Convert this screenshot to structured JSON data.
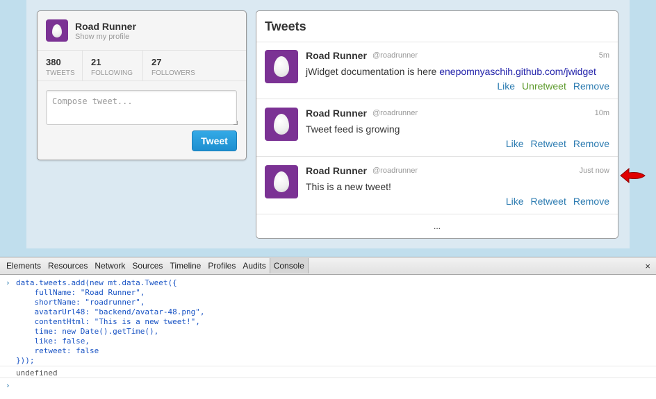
{
  "profile": {
    "name": "Road Runner",
    "link": "Show my profile",
    "stats": [
      {
        "num": "380",
        "label": "TWEETS"
      },
      {
        "num": "21",
        "label": "FOLLOWING"
      },
      {
        "num": "27",
        "label": "FOLLOWERS"
      }
    ],
    "compose_placeholder": "Compose tweet...",
    "tweet_button": "Tweet"
  },
  "tweets": {
    "title": "Tweets",
    "items": [
      {
        "name": "Road Runner",
        "handle": "@roadrunner",
        "time": "5m",
        "text": "jWidget documentation is here ",
        "link": "enepomnyaschih.github.com/jwidget",
        "like": "Like",
        "retweet": "Unretweet",
        "remove": "Remove"
      },
      {
        "name": "Road Runner",
        "handle": "@roadrunner",
        "time": "10m",
        "text": "Tweet feed is growing",
        "like": "Like",
        "retweet": "Retweet",
        "remove": "Remove"
      },
      {
        "name": "Road Runner",
        "handle": "@roadrunner",
        "time": "Just now",
        "text": "This is a new tweet!",
        "like": "Like",
        "retweet": "Retweet",
        "remove": "Remove"
      }
    ],
    "more": "..."
  },
  "devtools": {
    "tabs": [
      "Elements",
      "Resources",
      "Network",
      "Sources",
      "Timeline",
      "Profiles",
      "Audits",
      "Console"
    ],
    "active_tab": "Console",
    "close": "×",
    "prompt": "›",
    "code": [
      "data.tweets.add(new mt.data.Tweet({",
      "    fullName: \"Road Runner\",",
      "    shortName: \"roadrunner\",",
      "    avatarUrl48: \"backend/avatar-48.png\",",
      "    contentHtml: \"This is a new tweet!\",",
      "    time: new Date().getTime(),",
      "    like: false,",
      "    retweet: false",
      "}));"
    ],
    "result": "undefined"
  },
  "colors": {
    "accent": "#1d8fd0",
    "avatar": "#7b3294",
    "link": "#2a7ab0",
    "retweeted": "#5d9a2c",
    "arrow": "#e00000"
  }
}
